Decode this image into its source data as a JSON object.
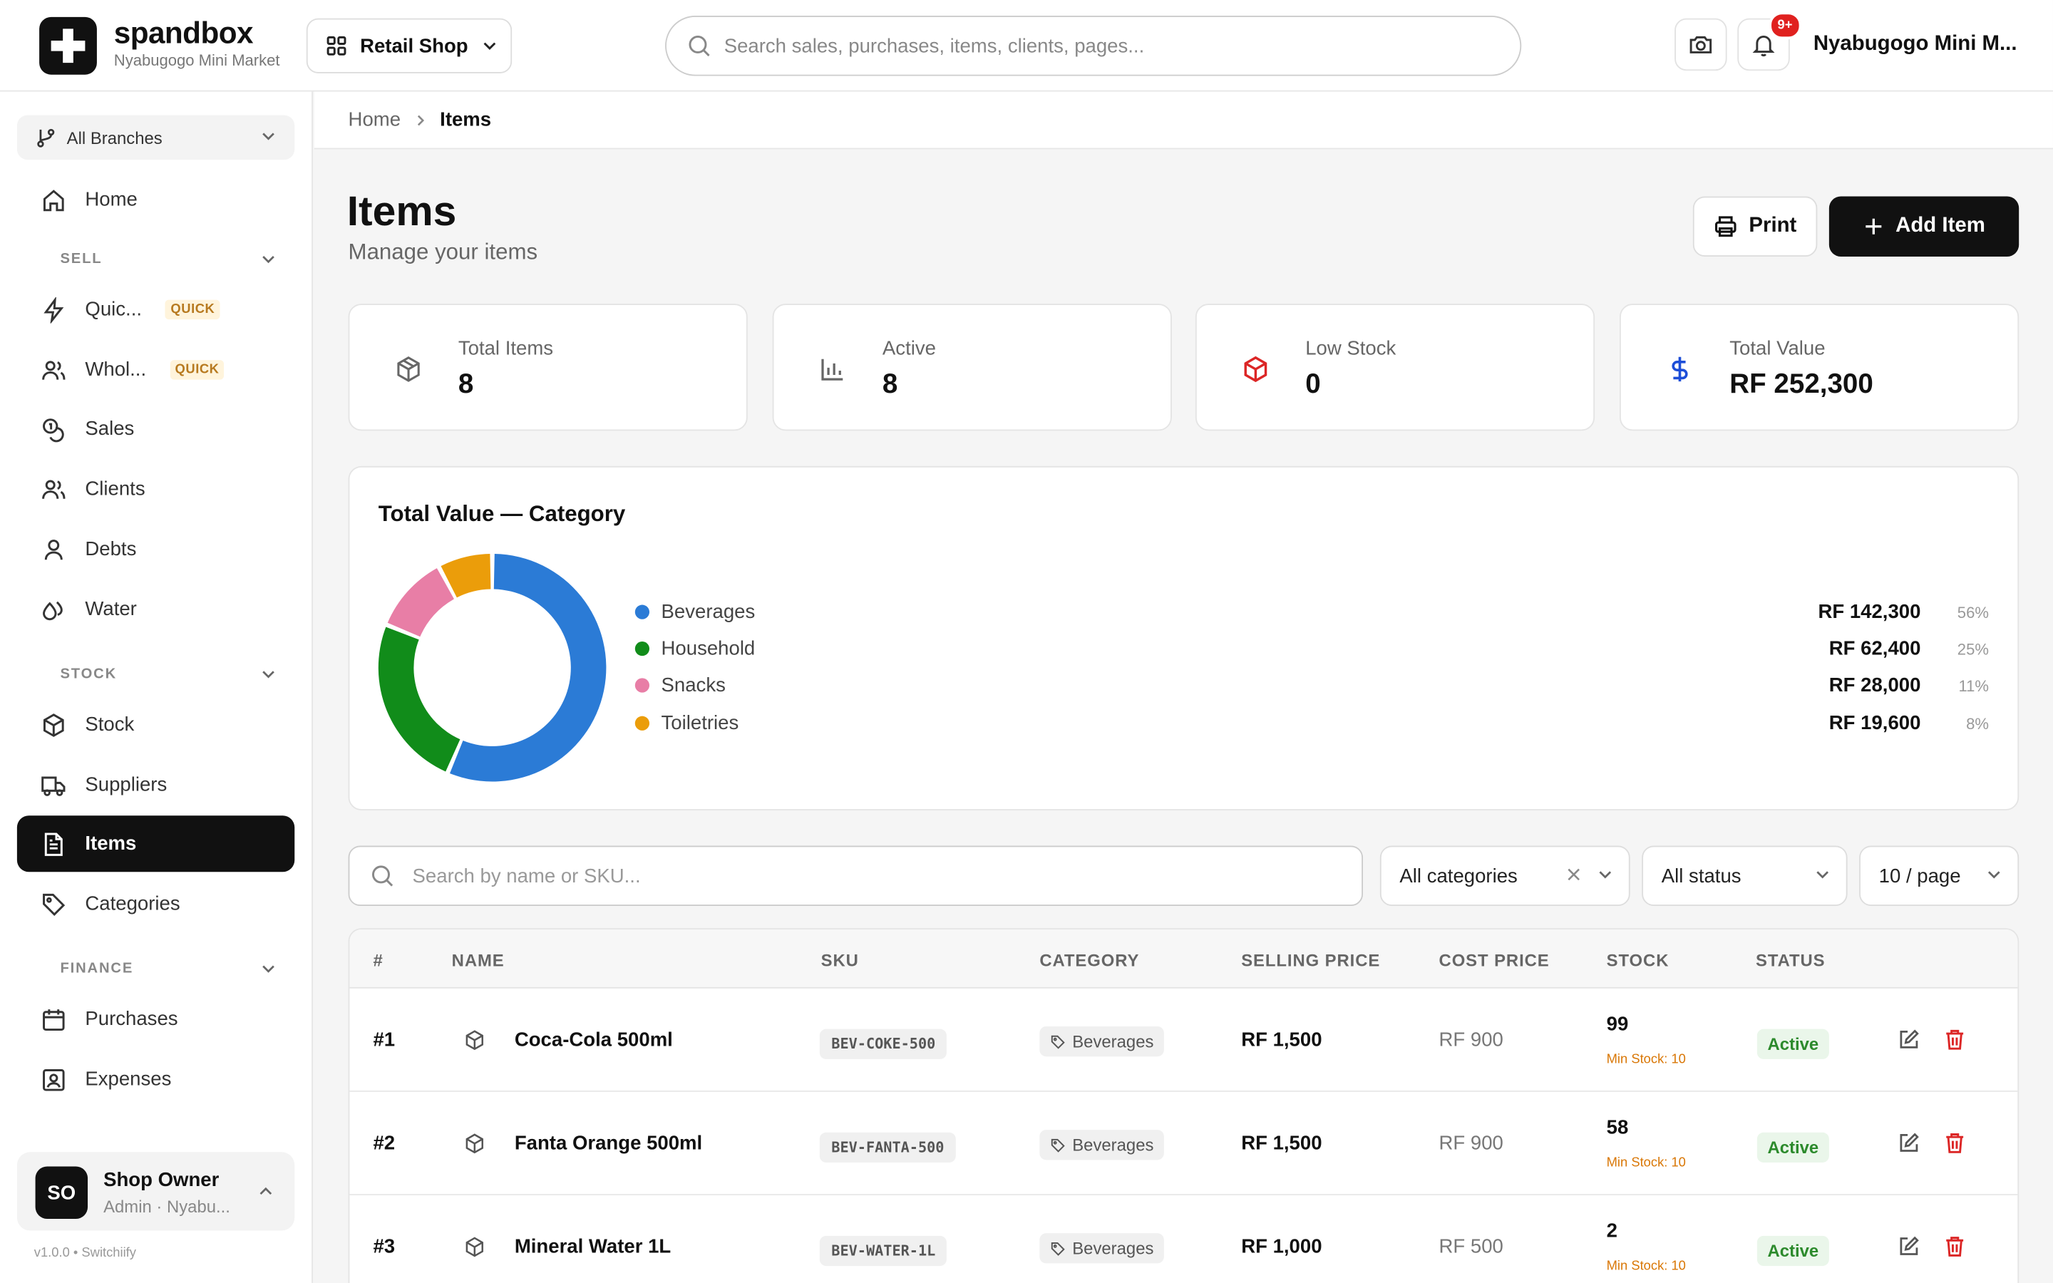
{
  "header": {
    "brand": "spandbox",
    "brand_sub": "Nyabugogo Mini Market",
    "shop_selector": "Retail Shop",
    "search_placeholder": "Search sales, purchases, items, clients, pages...",
    "notification_badge": "9+",
    "user_name": "Nyabugogo Mini M..."
  },
  "sidebar": {
    "branch": "All Branches",
    "home": "Home",
    "sections": {
      "sell": "SELL",
      "stock": "STOCK",
      "finance": "FINANCE"
    },
    "sell_items": [
      {
        "label": "Quic...",
        "badge": "QUICK"
      },
      {
        "label": "Whol...",
        "badge": "QUICK"
      },
      {
        "label": "Sales"
      },
      {
        "label": "Clients"
      },
      {
        "label": "Debts"
      },
      {
        "label": "Water"
      }
    ],
    "stock_items": [
      {
        "label": "Stock"
      },
      {
        "label": "Suppliers"
      },
      {
        "label": "Items"
      },
      {
        "label": "Categories"
      }
    ],
    "finance_items": [
      {
        "label": "Purchases"
      },
      {
        "label": "Expenses"
      }
    ],
    "user": {
      "initials": "SO",
      "name": "Shop Owner",
      "role": "Admin · Nyabu..."
    },
    "version": "v1.0.0 • Switchiify"
  },
  "breadcrumb": {
    "home": "Home",
    "current": "Items"
  },
  "page": {
    "title": "Items",
    "subtitle": "Manage your items",
    "print_label": "Print",
    "add_label": "Add Item"
  },
  "stats": [
    {
      "label": "Total Items",
      "value": "8"
    },
    {
      "label": "Active",
      "value": "8"
    },
    {
      "label": "Low Stock",
      "value": "0"
    },
    {
      "label": "Total Value",
      "value": "RF 252,300"
    }
  ],
  "chart_data": {
    "type": "pie",
    "title": "Total Value — Category",
    "categories": [
      "Beverages",
      "Household",
      "Snacks",
      "Toiletries"
    ],
    "values": [
      142300,
      62400,
      28000,
      19600
    ],
    "value_labels": [
      "RF 142,300",
      "RF 62,400",
      "RF 28,000",
      "RF 19,600"
    ],
    "percent_labels": [
      "56%",
      "25%",
      "11%",
      "8%"
    ],
    "colors": [
      "#2b7bd6",
      "#118c1a",
      "#e87ea6",
      "#eb9d0a"
    ]
  },
  "filters": {
    "search_placeholder": "Search by name or SKU...",
    "category": "All categories",
    "status": "All status",
    "page_size": "10 / page"
  },
  "table": {
    "columns": [
      "#",
      "NAME",
      "SKU",
      "CATEGORY",
      "SELLING PRICE",
      "COST PRICE",
      "STOCK",
      "STATUS"
    ],
    "rows": [
      {
        "num": "#1",
        "name": "Coca-Cola 500ml",
        "sku": "BEV-COKE-500",
        "category": "Beverages",
        "selling": "RF 1,500",
        "cost": "RF 900",
        "stock": "99",
        "min": "Min Stock: 10",
        "status": "Active"
      },
      {
        "num": "#2",
        "name": "Fanta Orange 500ml",
        "sku": "BEV-FANTA-500",
        "category": "Beverages",
        "selling": "RF 1,500",
        "cost": "RF 900",
        "stock": "58",
        "min": "Min Stock: 10",
        "status": "Active"
      },
      {
        "num": "#3",
        "name": "Mineral Water 1L",
        "sku": "BEV-WATER-1L",
        "category": "Beverages",
        "selling": "RF 1,000",
        "cost": "RF 500",
        "stock": "2",
        "min": "Min Stock: 10",
        "status": "Active"
      }
    ]
  }
}
